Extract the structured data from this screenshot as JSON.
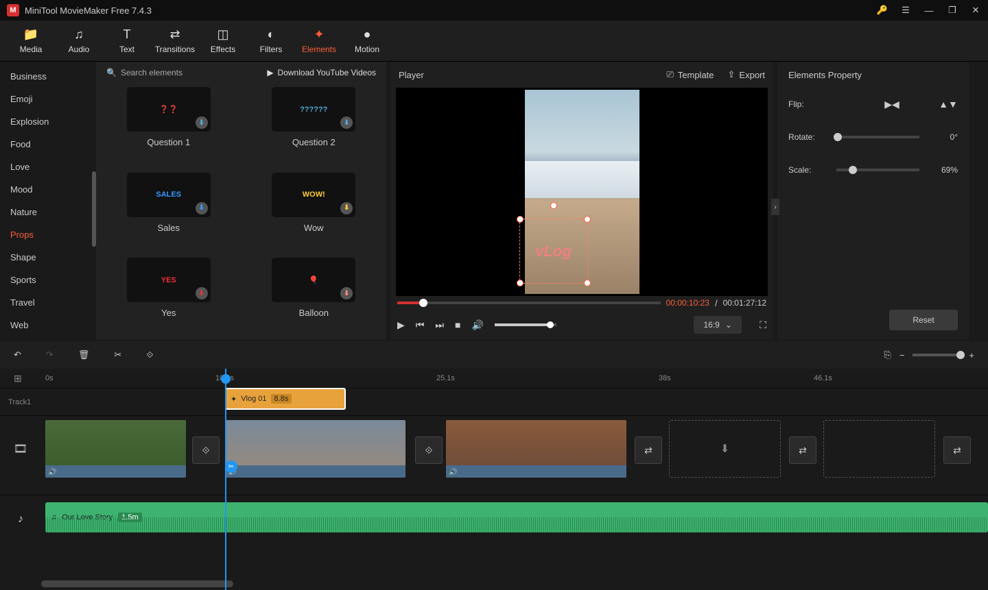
{
  "app_title": "MiniTool MovieMaker Free 7.4.3",
  "toolbar": [
    "Media",
    "Audio",
    "Text",
    "Transitions",
    "Effects",
    "Filters",
    "Elements",
    "Motion"
  ],
  "toolbar_active": "Elements",
  "categories": [
    "Business",
    "Emoji",
    "Explosion",
    "Food",
    "Love",
    "Mood",
    "Nature",
    "Props",
    "Shape",
    "Sports",
    "Travel",
    "Web"
  ],
  "category_active": "Props",
  "search_placeholder": "Search elements",
  "yt_link": "Download YouTube Videos",
  "elements": [
    {
      "label": "Question 1",
      "glyph": "❓❓",
      "bg": "#111"
    },
    {
      "label": "Question 2",
      "glyph": "??????",
      "bg": "#111"
    },
    {
      "label": "Sales",
      "glyph": "SALES",
      "bg": "#111"
    },
    {
      "label": "Wow",
      "glyph": "WOW!",
      "bg": "#111"
    },
    {
      "label": "Yes",
      "glyph": "YES",
      "bg": "#111"
    },
    {
      "label": "Balloon",
      "glyph": "🎈",
      "bg": "#111"
    }
  ],
  "player": {
    "title": "Player",
    "template": "Template",
    "export": "Export",
    "time_current": "00:00:10:23",
    "time_total": "00:01:27:12",
    "aspect": "16:9",
    "vlog_overlay": "vLog"
  },
  "props": {
    "title": "Elements Property",
    "flip": "Flip:",
    "rotate": "Rotate:",
    "rotate_val": "0°",
    "scale": "Scale:",
    "scale_val": "69%",
    "reset": "Reset"
  },
  "ruler": [
    {
      "pos": 66,
      "label": "0s"
    },
    {
      "pos": 314,
      "label": "10.9s"
    },
    {
      "pos": 636,
      "label": "25.1s"
    },
    {
      "pos": 960,
      "label": "38s"
    },
    {
      "pos": 1186,
      "label": "46.1s"
    }
  ],
  "timeline": {
    "track1": "Track1",
    "element_clip": {
      "name": "Vlog 01",
      "duration": "8.8s"
    },
    "audio": {
      "name": "Our Love Story",
      "duration": "1.5m"
    }
  }
}
